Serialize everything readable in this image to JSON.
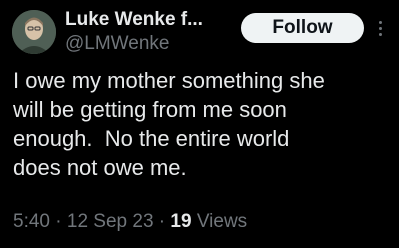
{
  "author": {
    "display_name": "Luke Wenke f...",
    "handle": "@LMWenke",
    "avatar_icon": "profile-photo"
  },
  "follow_button": {
    "label": "Follow"
  },
  "more_icon": "more-vertical-icon",
  "tweet": {
    "lines": [
      "I owe my mother something she",
      "will be getting from me soon",
      "enough.  No the entire world",
      "does not owe me."
    ]
  },
  "meta": {
    "time": "5:40",
    "separator": "·",
    "date": "12 Sep 23",
    "views_count": "19",
    "views_label": "Views"
  },
  "colors": {
    "background": "#000000",
    "primary_text": "#e7e9ea",
    "secondary_text": "#71767b",
    "button_bg": "#eff3f4",
    "button_text": "#0f1419"
  }
}
